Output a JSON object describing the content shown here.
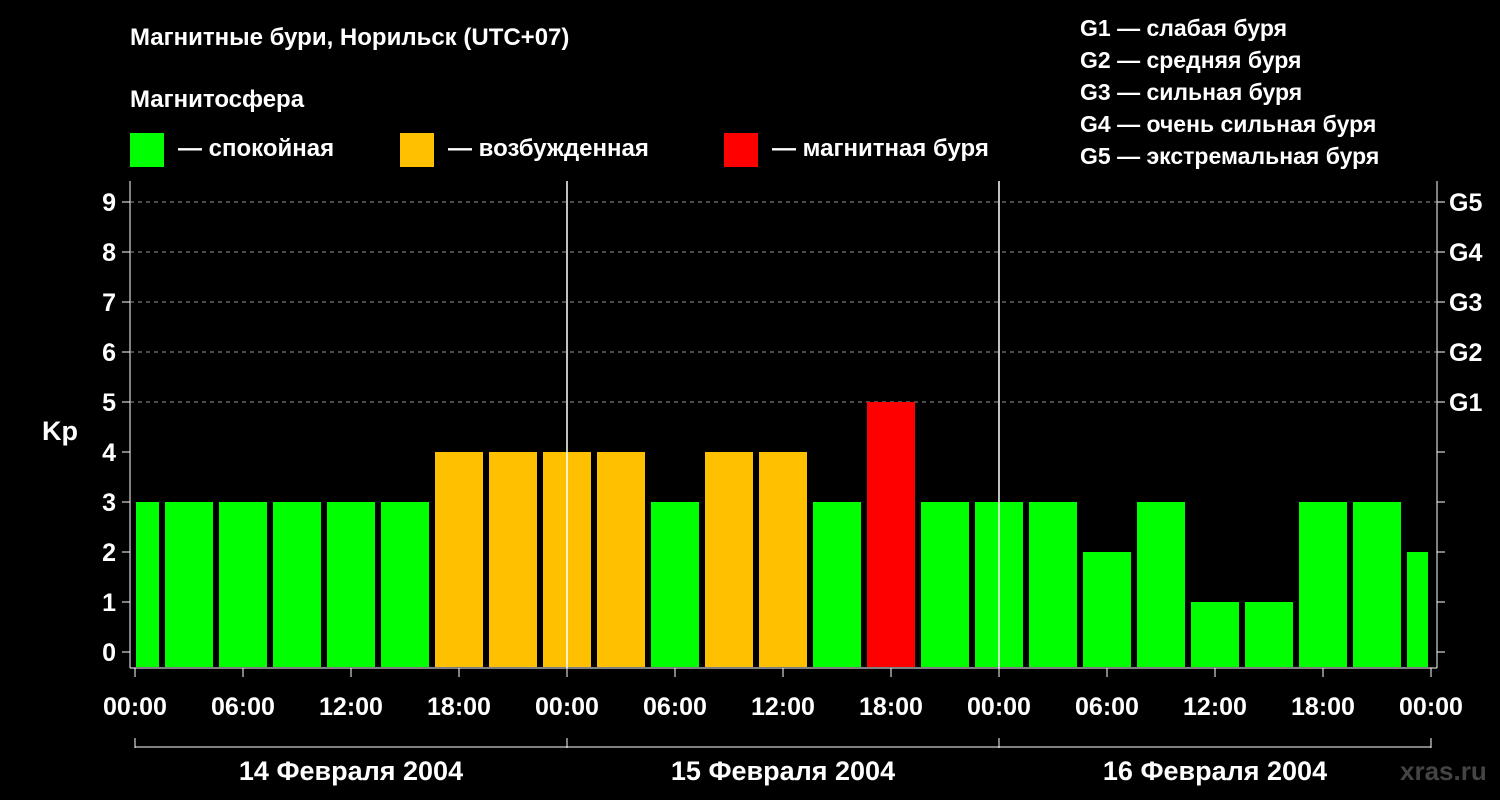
{
  "title": "Магнитные бури, Норильск (UTC+07)",
  "legend": {
    "heading": "Магнитосфера",
    "items": [
      {
        "label": "— спокойная",
        "color": "#00ff00"
      },
      {
        "label": "— возбужденная",
        "color": "#ffc000"
      },
      {
        "label": "— магнитная буря",
        "color": "#ff0000"
      }
    ]
  },
  "g_scale": [
    "G1 — слабая буря",
    "G2 — средняя буря",
    "G3 — сильная буря",
    "G4 — очень сильная буря",
    "G5 — экстремальная буря"
  ],
  "watermark": "xras.ru",
  "chart_data": {
    "type": "bar",
    "ylabel": "Kp",
    "ylim": [
      0,
      9
    ],
    "yticks": [
      "0",
      "1",
      "2",
      "3",
      "4",
      "5",
      "6",
      "7",
      "8",
      "9"
    ],
    "right_axis_labels": [
      {
        "kp": 5,
        "label": "G1"
      },
      {
        "kp": 6,
        "label": "G2"
      },
      {
        "kp": 7,
        "label": "G3"
      },
      {
        "kp": 8,
        "label": "G4"
      },
      {
        "kp": 9,
        "label": "G5"
      }
    ],
    "xticks": [
      "00:00",
      "06:00",
      "12:00",
      "18:00",
      "00:00",
      "06:00",
      "12:00",
      "18:00",
      "00:00",
      "06:00",
      "12:00",
      "18:00",
      "00:00"
    ],
    "days": [
      "14 Февраля 2004",
      "15 Февраля 2004",
      "16 Февраля 2004"
    ],
    "grid": true,
    "values": [
      3,
      3,
      3,
      3,
      3,
      3,
      4,
      4,
      4,
      4,
      3,
      4,
      4,
      3,
      5,
      3,
      3,
      3,
      2,
      3,
      1,
      1,
      3,
      3,
      2
    ],
    "colors": {
      "quiet": "#00ff00",
      "active": "#ffc000",
      "storm": "#ff0000"
    }
  }
}
